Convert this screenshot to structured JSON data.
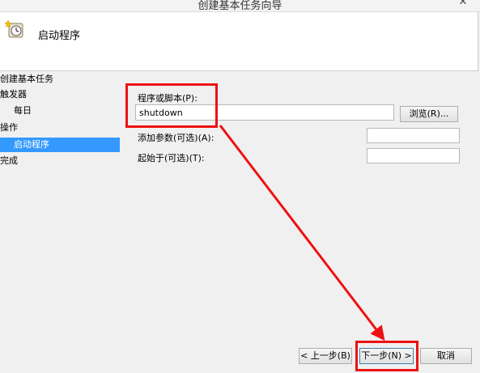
{
  "window": {
    "title": "创建基本任务向导"
  },
  "header": {
    "title": "启动程序"
  },
  "nav": {
    "items": [
      {
        "label": "创建基本任务"
      },
      {
        "label": "触发器"
      },
      {
        "label": "每日"
      },
      {
        "label": "操作"
      },
      {
        "label": "启动程序"
      },
      {
        "label": "完成"
      }
    ]
  },
  "form": {
    "program_label": "程序或脚本(P):",
    "program_value": "shutdown",
    "browse_label": "浏览(R)...",
    "args_label": "添加参数(可选)(A):",
    "args_value": "",
    "startin_label": "起始于(可选)(T):",
    "startin_value": ""
  },
  "footer": {
    "back_label": "< 上一步(B)",
    "next_label": "下一步(N) >",
    "cancel_label": "取消"
  },
  "colors": {
    "selection": "#3399ff",
    "annotation": "#ee1111"
  },
  "icons": {
    "header": "clock-task-icon",
    "close": "close-icon"
  }
}
